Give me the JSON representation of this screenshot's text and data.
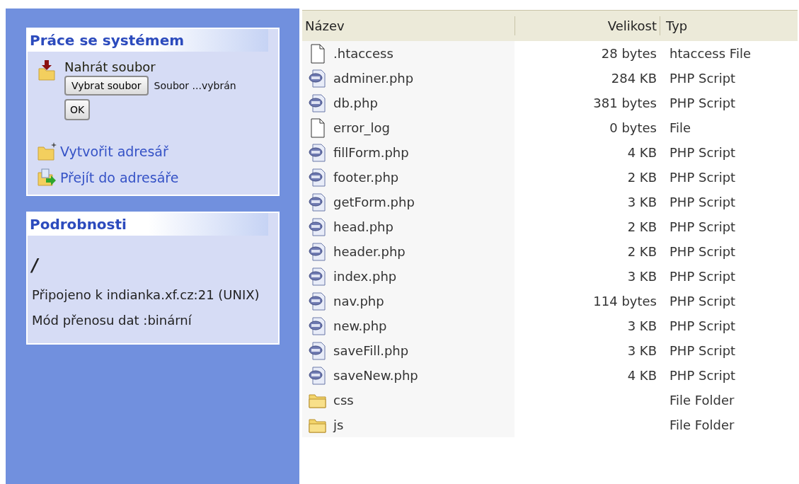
{
  "sidebar": {
    "panels": [
      {
        "kind": "actions",
        "title": "Práce se systémem",
        "upload": {
          "label": "Nahrát soubor",
          "choose_button": "Vybrat soubor",
          "file_status": "Soubor ...vybrán",
          "ok_button": "OK"
        },
        "links": [
          {
            "kind": "new-folder",
            "label": "Vytvořit adresář"
          },
          {
            "kind": "go-folder",
            "label": "Přejít do adresáře"
          }
        ]
      },
      {
        "kind": "details",
        "title": "Podrobnosti",
        "path": "/",
        "lines": [
          "Připojeno k indianka.xf.cz:21 (UNIX)",
          "Mód přenosu dat :binární"
        ]
      }
    ]
  },
  "table": {
    "columns": [
      "Název",
      "Velikost",
      "Typ"
    ],
    "rows": [
      {
        "kind": "file",
        "name": ".htaccess",
        "size": "28 bytes",
        "type": "htaccess File"
      },
      {
        "kind": "php",
        "name": "adminer.php",
        "size": "284 KB",
        "type": "PHP Script"
      },
      {
        "kind": "php",
        "name": "db.php",
        "size": "381 bytes",
        "type": "PHP Script"
      },
      {
        "kind": "file",
        "name": "error_log",
        "size": "0 bytes",
        "type": "File"
      },
      {
        "kind": "php",
        "name": "fillForm.php",
        "size": "4 KB",
        "type": "PHP Script"
      },
      {
        "kind": "php",
        "name": "footer.php",
        "size": "2 KB",
        "type": "PHP Script"
      },
      {
        "kind": "php",
        "name": "getForm.php",
        "size": "3 KB",
        "type": "PHP Script"
      },
      {
        "kind": "php",
        "name": "head.php",
        "size": "2 KB",
        "type": "PHP Script"
      },
      {
        "kind": "php",
        "name": "header.php",
        "size": "2 KB",
        "type": "PHP Script"
      },
      {
        "kind": "php",
        "name": "index.php",
        "size": "3 KB",
        "type": "PHP Script"
      },
      {
        "kind": "php",
        "name": "nav.php",
        "size": "114 bytes",
        "type": "PHP Script"
      },
      {
        "kind": "php",
        "name": "new.php",
        "size": "3 KB",
        "type": "PHP Script"
      },
      {
        "kind": "php",
        "name": "saveFill.php",
        "size": "3 KB",
        "type": "PHP Script"
      },
      {
        "kind": "php",
        "name": "saveNew.php",
        "size": "4 KB",
        "type": "PHP Script"
      },
      {
        "kind": "folder",
        "name": "css",
        "type": "File Folder"
      },
      {
        "kind": "folder",
        "name": "js",
        "type": "File Folder"
      }
    ]
  }
}
